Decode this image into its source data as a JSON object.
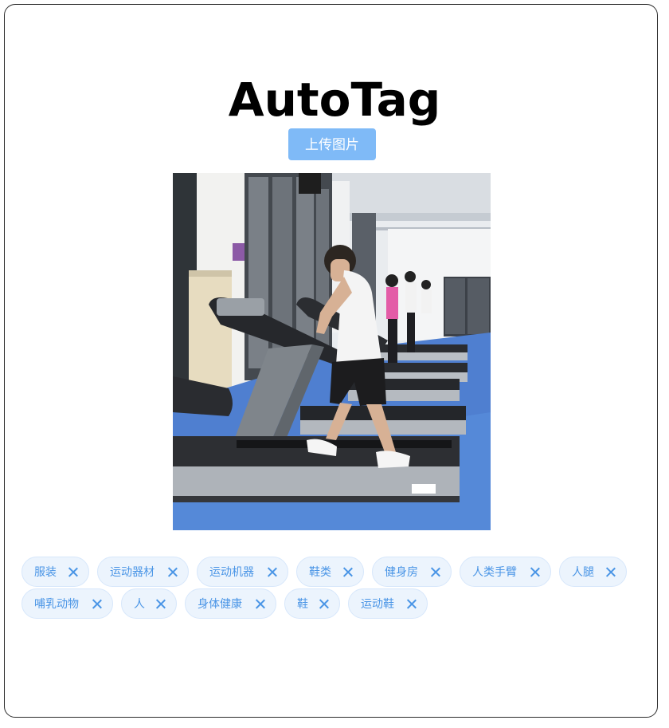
{
  "app": {
    "title": "AutoTag"
  },
  "upload": {
    "label": "上传图片"
  },
  "image": {
    "subject": "people walking on treadmills in a gym"
  },
  "tags": [
    {
      "label": "服装"
    },
    {
      "label": "运动器材"
    },
    {
      "label": "运动机器"
    },
    {
      "label": "鞋类"
    },
    {
      "label": "健身房"
    },
    {
      "label": "人类手臂"
    },
    {
      "label": "人腿"
    },
    {
      "label": "哺乳动物"
    },
    {
      "label": "人"
    },
    {
      "label": "身体健康"
    },
    {
      "label": "鞋"
    },
    {
      "label": "运动鞋"
    }
  ],
  "colors": {
    "accent": "#7fbaf7",
    "tag_text": "#4a95e6",
    "tag_bg": "#ecf4fd"
  },
  "icons": {
    "tag_remove": "close-icon"
  }
}
